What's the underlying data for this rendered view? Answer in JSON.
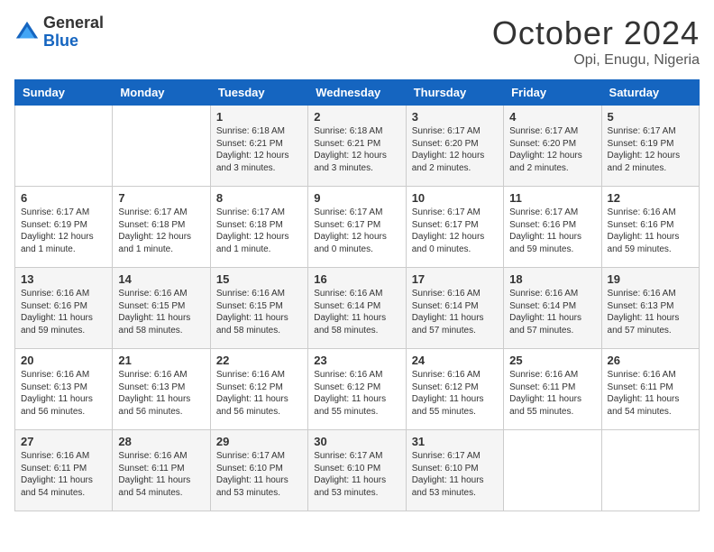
{
  "header": {
    "logo_general": "General",
    "logo_blue": "Blue",
    "month_title": "October 2024",
    "location": "Opi, Enugu, Nigeria"
  },
  "weekdays": [
    "Sunday",
    "Monday",
    "Tuesday",
    "Wednesday",
    "Thursday",
    "Friday",
    "Saturday"
  ],
  "weeks": [
    [
      {
        "day": "",
        "content": ""
      },
      {
        "day": "",
        "content": ""
      },
      {
        "day": "1",
        "content": "Sunrise: 6:18 AM\nSunset: 6:21 PM\nDaylight: 12 hours and 3 minutes."
      },
      {
        "day": "2",
        "content": "Sunrise: 6:18 AM\nSunset: 6:21 PM\nDaylight: 12 hours and 3 minutes."
      },
      {
        "day": "3",
        "content": "Sunrise: 6:17 AM\nSunset: 6:20 PM\nDaylight: 12 hours and 2 minutes."
      },
      {
        "day": "4",
        "content": "Sunrise: 6:17 AM\nSunset: 6:20 PM\nDaylight: 12 hours and 2 minutes."
      },
      {
        "day": "5",
        "content": "Sunrise: 6:17 AM\nSunset: 6:19 PM\nDaylight: 12 hours and 2 minutes."
      }
    ],
    [
      {
        "day": "6",
        "content": "Sunrise: 6:17 AM\nSunset: 6:19 PM\nDaylight: 12 hours and 1 minute."
      },
      {
        "day": "7",
        "content": "Sunrise: 6:17 AM\nSunset: 6:18 PM\nDaylight: 12 hours and 1 minute."
      },
      {
        "day": "8",
        "content": "Sunrise: 6:17 AM\nSunset: 6:18 PM\nDaylight: 12 hours and 1 minute."
      },
      {
        "day": "9",
        "content": "Sunrise: 6:17 AM\nSunset: 6:17 PM\nDaylight: 12 hours and 0 minutes."
      },
      {
        "day": "10",
        "content": "Sunrise: 6:17 AM\nSunset: 6:17 PM\nDaylight: 12 hours and 0 minutes."
      },
      {
        "day": "11",
        "content": "Sunrise: 6:17 AM\nSunset: 6:16 PM\nDaylight: 11 hours and 59 minutes."
      },
      {
        "day": "12",
        "content": "Sunrise: 6:16 AM\nSunset: 6:16 PM\nDaylight: 11 hours and 59 minutes."
      }
    ],
    [
      {
        "day": "13",
        "content": "Sunrise: 6:16 AM\nSunset: 6:16 PM\nDaylight: 11 hours and 59 minutes."
      },
      {
        "day": "14",
        "content": "Sunrise: 6:16 AM\nSunset: 6:15 PM\nDaylight: 11 hours and 58 minutes."
      },
      {
        "day": "15",
        "content": "Sunrise: 6:16 AM\nSunset: 6:15 PM\nDaylight: 11 hours and 58 minutes."
      },
      {
        "day": "16",
        "content": "Sunrise: 6:16 AM\nSunset: 6:14 PM\nDaylight: 11 hours and 58 minutes."
      },
      {
        "day": "17",
        "content": "Sunrise: 6:16 AM\nSunset: 6:14 PM\nDaylight: 11 hours and 57 minutes."
      },
      {
        "day": "18",
        "content": "Sunrise: 6:16 AM\nSunset: 6:14 PM\nDaylight: 11 hours and 57 minutes."
      },
      {
        "day": "19",
        "content": "Sunrise: 6:16 AM\nSunset: 6:13 PM\nDaylight: 11 hours and 57 minutes."
      }
    ],
    [
      {
        "day": "20",
        "content": "Sunrise: 6:16 AM\nSunset: 6:13 PM\nDaylight: 11 hours and 56 minutes."
      },
      {
        "day": "21",
        "content": "Sunrise: 6:16 AM\nSunset: 6:13 PM\nDaylight: 11 hours and 56 minutes."
      },
      {
        "day": "22",
        "content": "Sunrise: 6:16 AM\nSunset: 6:12 PM\nDaylight: 11 hours and 56 minutes."
      },
      {
        "day": "23",
        "content": "Sunrise: 6:16 AM\nSunset: 6:12 PM\nDaylight: 11 hours and 55 minutes."
      },
      {
        "day": "24",
        "content": "Sunrise: 6:16 AM\nSunset: 6:12 PM\nDaylight: 11 hours and 55 minutes."
      },
      {
        "day": "25",
        "content": "Sunrise: 6:16 AM\nSunset: 6:11 PM\nDaylight: 11 hours and 55 minutes."
      },
      {
        "day": "26",
        "content": "Sunrise: 6:16 AM\nSunset: 6:11 PM\nDaylight: 11 hours and 54 minutes."
      }
    ],
    [
      {
        "day": "27",
        "content": "Sunrise: 6:16 AM\nSunset: 6:11 PM\nDaylight: 11 hours and 54 minutes."
      },
      {
        "day": "28",
        "content": "Sunrise: 6:16 AM\nSunset: 6:11 PM\nDaylight: 11 hours and 54 minutes."
      },
      {
        "day": "29",
        "content": "Sunrise: 6:17 AM\nSunset: 6:10 PM\nDaylight: 11 hours and 53 minutes."
      },
      {
        "day": "30",
        "content": "Sunrise: 6:17 AM\nSunset: 6:10 PM\nDaylight: 11 hours and 53 minutes."
      },
      {
        "day": "31",
        "content": "Sunrise: 6:17 AM\nSunset: 6:10 PM\nDaylight: 11 hours and 53 minutes."
      },
      {
        "day": "",
        "content": ""
      },
      {
        "day": "",
        "content": ""
      }
    ]
  ]
}
